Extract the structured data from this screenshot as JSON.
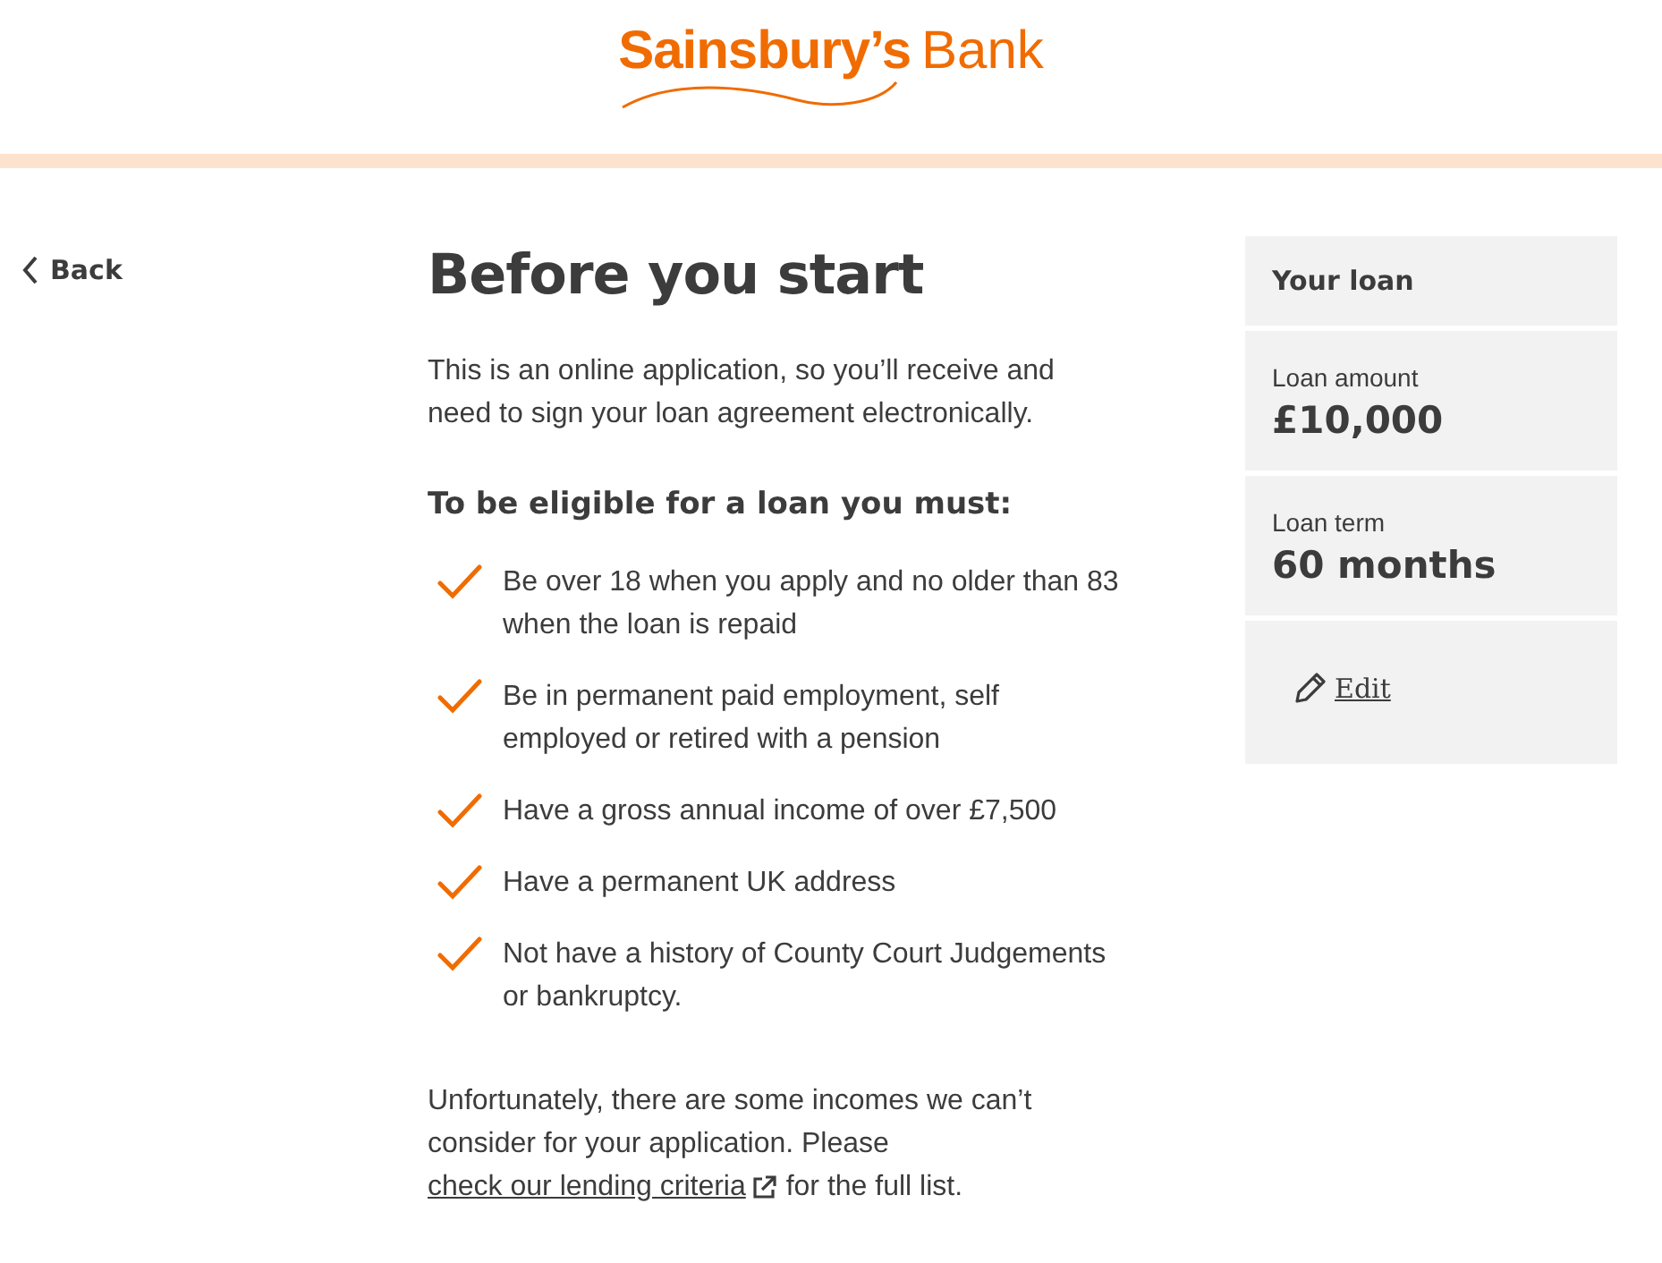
{
  "logo": {
    "name": "Sainsbury’s",
    "suffix": "Bank"
  },
  "back": {
    "label": "Back"
  },
  "title": "Before you start",
  "intro": "This is an online application, so you’ll receive and need to sign your loan agreement electronically.",
  "eligibility": {
    "heading": "To be eligible for a loan you must:",
    "items": [
      "Be over 18 when you apply and no older than 83 when the loan is repaid",
      "Be in permanent paid employment, self employed or retired with a pension",
      "Have a gross annual income of over £7,500",
      "Have a permanent UK address",
      "Not have a history of County Court Judgements or bankruptcy."
    ]
  },
  "note": {
    "text": "Unfortunately, there are some incomes we can’t consider for your application. Please",
    "link": "check our lending criteria",
    "after": "for the full list."
  },
  "summary": {
    "title": "Your loan",
    "fields": [
      {
        "label": "Loan amount",
        "value": "£10,000"
      },
      {
        "label": "Loan term",
        "value": "60 months"
      }
    ],
    "edit": "Edit"
  }
}
